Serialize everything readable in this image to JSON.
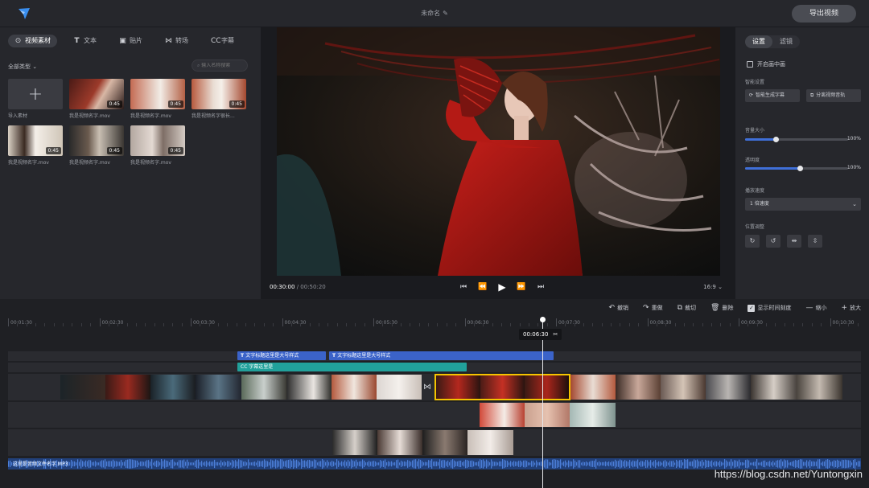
{
  "app": {
    "title": "未命名",
    "export_label": "导出视频"
  },
  "left_tabs": [
    {
      "label": "视频素材",
      "icon": "video-icon"
    },
    {
      "label": "文本",
      "icon": "text-icon"
    },
    {
      "label": "贴片",
      "icon": "sticker-icon"
    },
    {
      "label": "转场",
      "icon": "transition-icon"
    },
    {
      "label": "字幕",
      "icon": "subtitle-icon"
    }
  ],
  "filter_label": "全部类型",
  "search_placeholder": "输入名称搜索",
  "media": [
    {
      "name": "导入素材",
      "duration": ""
    },
    {
      "name": "我是视频名字.mov",
      "duration": "0:45"
    },
    {
      "name": "我是视频名字.mov",
      "duration": "0:45"
    },
    {
      "name": "我是视频名字很长...",
      "duration": "0:45"
    },
    {
      "name": "我是视频名字.mov",
      "duration": "0:45"
    },
    {
      "name": "我是视频名字.mov",
      "duration": "0:45"
    },
    {
      "name": "我是视频名字.mov",
      "duration": "0:45"
    }
  ],
  "player": {
    "current": "00:30:00",
    "total": "00:50:20",
    "ratio": "16:9"
  },
  "right_panel": {
    "tabs": [
      "设置",
      "滤镜"
    ],
    "open_mid_label": "开启画中画",
    "smart_label": "智能设置",
    "smart_btn1": "智能生成字幕",
    "smart_btn2": "分离视频音轨",
    "volume_label": "音量大小",
    "volume_value": "100%",
    "volume_fraction": 0.3,
    "opacity_label": "透明度",
    "opacity_value": "100%",
    "opacity_fraction": 0.53,
    "speed_label": "播放速度",
    "speed_value": "1 倍速度",
    "position_label": "位置调整"
  },
  "timeline": {
    "tools": [
      {
        "label": "撤销",
        "icon": "undo-icon"
      },
      {
        "label": "重做",
        "icon": "redo-icon"
      },
      {
        "label": "裁切",
        "icon": "crop-icon"
      },
      {
        "label": "删除",
        "icon": "delete-icon"
      },
      {
        "label": "显示时间刻度",
        "icon": "checkbox-icon"
      },
      {
        "label": "缩小",
        "icon": "zoom-out-icon"
      },
      {
        "label": "放大",
        "icon": "zoom-in-icon"
      }
    ],
    "ruler": [
      "00:01:30",
      "00:02:30",
      "00:03:30",
      "00:04:30",
      "00:05:30",
      "00:06:30",
      "00:07:30",
      "00:08:30",
      "00:09:30",
      "00:10:30"
    ],
    "playhead_time": "00:06:30",
    "text_clips": [
      "文字标题这里是大号样式",
      "文字标题这里是大号样式"
    ],
    "subtitle_clip": "字幕这里是",
    "audio_name": "这里是音频文件名字.MP3"
  },
  "watermark": "https://blog.csdn.net/Yuntongxin",
  "colors": {
    "accent": "#3f6fd8",
    "text_clip": "#3b63c9",
    "sub_clip": "#21a19b",
    "selected": "#f5c400"
  }
}
